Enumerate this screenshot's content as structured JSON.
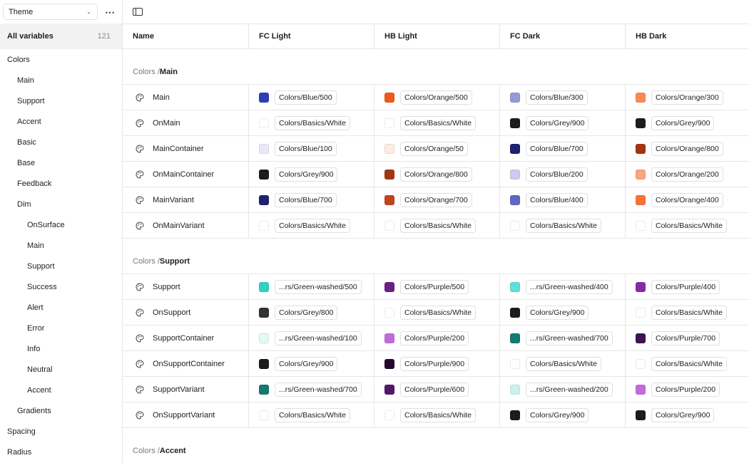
{
  "sidebar": {
    "mode_select": "Theme",
    "all_variables_label": "All variables",
    "all_variables_count": "121",
    "items": [
      {
        "label": "Colors",
        "level": 0
      },
      {
        "label": "Main",
        "level": 1
      },
      {
        "label": "Support",
        "level": 1
      },
      {
        "label": "Accent",
        "level": 1
      },
      {
        "label": "Basic",
        "level": 1
      },
      {
        "label": "Base",
        "level": 1
      },
      {
        "label": "Feedback",
        "level": 1
      },
      {
        "label": "Dim",
        "level": 1
      },
      {
        "label": "OnSurface",
        "level": 2
      },
      {
        "label": "Main",
        "level": 2
      },
      {
        "label": "Support",
        "level": 2
      },
      {
        "label": "Success",
        "level": 2
      },
      {
        "label": "Alert",
        "level": 2
      },
      {
        "label": "Error",
        "level": 2
      },
      {
        "label": "Info",
        "level": 2
      },
      {
        "label": "Neutral",
        "level": 2
      },
      {
        "label": "Accent",
        "level": 2
      },
      {
        "label": "Gradients",
        "level": 1
      },
      {
        "label": "Spacing",
        "level": 0
      },
      {
        "label": "Radius",
        "level": 0
      }
    ]
  },
  "table": {
    "columns": [
      "Name",
      "FC Light",
      "HB Light",
      "FC Dark",
      "HB Dark"
    ],
    "groups": [
      {
        "crumb": "Colors / ",
        "name": "Main",
        "rows": [
          {
            "name": "Main",
            "values": [
              {
                "ref": "Colors/Blue/500",
                "color": "#2e3db8"
              },
              {
                "ref": "Colors/Orange/500",
                "color": "#f0591a"
              },
              {
                "ref": "Colors/Blue/300",
                "color": "#9499d8"
              },
              {
                "ref": "Colors/Orange/300",
                "color": "#f98a52"
              }
            ]
          },
          {
            "name": "OnMain",
            "values": [
              {
                "ref": "Colors/Basics/White",
                "color": "#ffffff"
              },
              {
                "ref": "Colors/Basics/White",
                "color": "#ffffff"
              },
              {
                "ref": "Colors/Grey/900",
                "color": "#1c1c1c"
              },
              {
                "ref": "Colors/Grey/900",
                "color": "#1c1c1c"
              }
            ]
          },
          {
            "name": "MainContainer",
            "values": [
              {
                "ref": "Colors/Blue/100",
                "color": "#e8e8f6"
              },
              {
                "ref": "Colors/Orange/50",
                "color": "#fdebe4"
              },
              {
                "ref": "Colors/Blue/700",
                "color": "#1e2270"
              },
              {
                "ref": "Colors/Orange/800",
                "color": "#a3360f"
              }
            ]
          },
          {
            "name": "OnMainContainer",
            "values": [
              {
                "ref": "Colors/Grey/900",
                "color": "#1c1c1c"
              },
              {
                "ref": "Colors/Orange/800",
                "color": "#a3360f"
              },
              {
                "ref": "Colors/Blue/200",
                "color": "#cccdee"
              },
              {
                "ref": "Colors/Orange/200",
                "color": "#fca47a"
              }
            ]
          },
          {
            "name": "MainVariant",
            "values": [
              {
                "ref": "Colors/Blue/700",
                "color": "#1e2270"
              },
              {
                "ref": "Colors/Orange/700",
                "color": "#c2441a"
              },
              {
                "ref": "Colors/Blue/400",
                "color": "#5f66c6"
              },
              {
                "ref": "Colors/Orange/400",
                "color": "#f97238"
              }
            ]
          },
          {
            "name": "OnMainVariant",
            "values": [
              {
                "ref": "Colors/Basics/White",
                "color": "#ffffff"
              },
              {
                "ref": "Colors/Basics/White",
                "color": "#ffffff"
              },
              {
                "ref": "Colors/Basics/White",
                "color": "#ffffff"
              },
              {
                "ref": "Colors/Basics/White",
                "color": "#ffffff"
              }
            ]
          }
        ]
      },
      {
        "crumb": "Colors / ",
        "name": "Support",
        "rows": [
          {
            "name": "Support",
            "values": [
              {
                "ref": "...rs/Green-washed/500",
                "color": "#2ed3c7"
              },
              {
                "ref": "Colors/Purple/500",
                "color": "#6a1f86"
              },
              {
                "ref": "...rs/Green-washed/400",
                "color": "#5fe0d8"
              },
              {
                "ref": "Colors/Purple/400",
                "color": "#8a2ba6"
              }
            ]
          },
          {
            "name": "OnSupport",
            "values": [
              {
                "ref": "Colors/Grey/800",
                "color": "#333333"
              },
              {
                "ref": "Colors/Basics/White",
                "color": "#ffffff"
              },
              {
                "ref": "Colors/Grey/900",
                "color": "#1c1c1c"
              },
              {
                "ref": "Colors/Basics/White",
                "color": "#ffffff"
              }
            ]
          },
          {
            "name": "SupportContainer",
            "values": [
              {
                "ref": "...rs/Green-washed/100",
                "color": "#e4f8f6"
              },
              {
                "ref": "Colors/Purple/200",
                "color": "#c06ddb"
              },
              {
                "ref": "...rs/Green-washed/700",
                "color": "#147a72"
              },
              {
                "ref": "Colors/Purple/700",
                "color": "#3d1350"
              }
            ]
          },
          {
            "name": "OnSupportContainer",
            "values": [
              {
                "ref": "Colors/Grey/900",
                "color": "#1c1c1c"
              },
              {
                "ref": "Colors/Purple/900",
                "color": "#240a30"
              },
              {
                "ref": "Colors/Basics/White",
                "color": "#ffffff"
              },
              {
                "ref": "Colors/Basics/White",
                "color": "#ffffff"
              }
            ]
          },
          {
            "name": "SupportVariant",
            "values": [
              {
                "ref": "...rs/Green-washed/700",
                "color": "#147a72"
              },
              {
                "ref": "Colors/Purple/600",
                "color": "#521868"
              },
              {
                "ref": "...rs/Green-washed/200",
                "color": "#c8f2ee"
              },
              {
                "ref": "Colors/Purple/200",
                "color": "#c06ddb"
              }
            ]
          },
          {
            "name": "OnSupportVariant",
            "values": [
              {
                "ref": "Colors/Basics/White",
                "color": "#ffffff"
              },
              {
                "ref": "Colors/Basics/White",
                "color": "#ffffff"
              },
              {
                "ref": "Colors/Grey/900",
                "color": "#1c1c1c"
              },
              {
                "ref": "Colors/Grey/900",
                "color": "#1c1c1c"
              }
            ]
          }
        ]
      },
      {
        "crumb": "Colors / ",
        "name": "Accent",
        "rows": []
      }
    ]
  }
}
